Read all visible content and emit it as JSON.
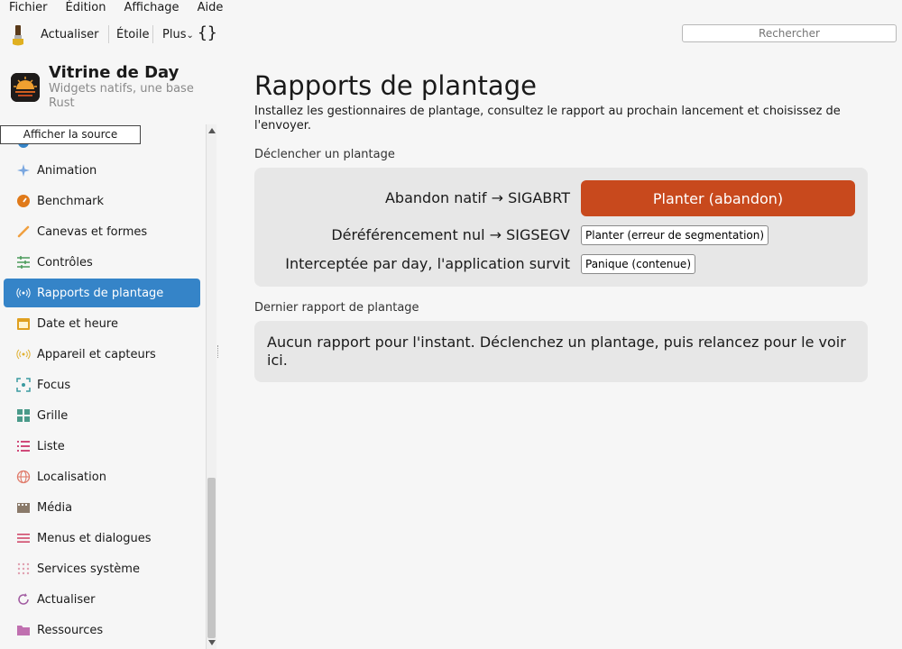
{
  "menubar": [
    "Fichier",
    "Édition",
    "Affichage",
    "Aide"
  ],
  "toolbar": {
    "refresh": "Actualiser",
    "star": "Étoile",
    "more": "Plus",
    "more_chevron": "⌄",
    "braces": "{}",
    "search_placeholder": "Rechercher"
  },
  "app": {
    "title": "Vitrine de Day",
    "subtitle": "Widgets natifs, une base Rust"
  },
  "tooltip": "Afficher la source",
  "sidebar": {
    "items": [
      {
        "label": "Animation",
        "icon": "sparkle-icon",
        "color": "#7aa7e0"
      },
      {
        "label": "Benchmark",
        "icon": "gauge-icon",
        "color": "#e07a1a"
      },
      {
        "label": "Canevas et formes",
        "icon": "brush-icon",
        "color": "#f0a040"
      },
      {
        "label": "Contrôles",
        "icon": "sliders-icon",
        "color": "#4a9a5a"
      },
      {
        "label": "Rapports de plantage",
        "icon": "broadcast-icon",
        "color": "#ffffff"
      },
      {
        "label": "Date et heure",
        "icon": "calendar-icon",
        "color": "#e0a020"
      },
      {
        "label": "Appareil et capteurs",
        "icon": "signal-icon",
        "color": "#e0b030"
      },
      {
        "label": "Focus",
        "icon": "focus-icon",
        "color": "#3a9aa0"
      },
      {
        "label": "Grille",
        "icon": "grid-icon",
        "color": "#4a9a8a"
      },
      {
        "label": "Liste",
        "icon": "list-icon",
        "color": "#d04a7a"
      },
      {
        "label": "Localisation",
        "icon": "globe-icon",
        "color": "#e07a6a"
      },
      {
        "label": "Média",
        "icon": "film-icon",
        "color": "#8a7a6a"
      },
      {
        "label": "Menus et dialogues",
        "icon": "menu-icon",
        "color": "#d04a6a"
      },
      {
        "label": "Services système",
        "icon": "dots-grid-icon",
        "color": "#e0a0b0"
      },
      {
        "label": "Actualiser",
        "icon": "refresh-icon",
        "color": "#a05aa0"
      },
      {
        "label": "Ressources",
        "icon": "folder-icon",
        "color": "#c070b0"
      }
    ],
    "active": "Rapports de plantage"
  },
  "main": {
    "title": "Rapports de plantage",
    "description": "Installez les gestionnaires de plantage, consultez le rapport au prochain lancement et choisissez de l'envoyer.",
    "trigger_section": "Déclencher un plantage",
    "rows": [
      {
        "label": "Abandon natif → SIGABRT",
        "button": "Planter (abandon)"
      },
      {
        "label": "Déréférencement nul → SIGSEGV",
        "button": "Planter (erreur de segmentation)"
      },
      {
        "label": "Interceptée par day, l'application survit",
        "button": "Panique (contenue)"
      }
    ],
    "report_section": "Dernier rapport de plantage",
    "report_text": "Aucun rapport pour l'instant. Déclenchez un plantage, puis relancez pour le voir ici."
  },
  "colors": {
    "accent": "#3584c8",
    "danger_button": "#c8491d"
  }
}
